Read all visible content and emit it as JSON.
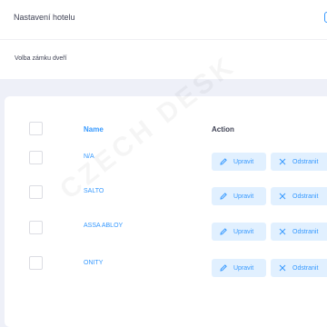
{
  "header": {
    "title": "Nastavení hotelu"
  },
  "subheader": {
    "title": "Volba zámku dveří"
  },
  "watermark": {
    "text": "CZECH DESK"
  },
  "table": {
    "columns": {
      "name": "Name",
      "action": "Action"
    },
    "rows": [
      {
        "name": "N/A"
      },
      {
        "name": "SALTO"
      },
      {
        "name": "ASSA ABLOY"
      },
      {
        "name": "ONITY"
      }
    ],
    "edit_label": "Upravit",
    "delete_label": "Odstranit"
  },
  "colors": {
    "accent": "#3699ff",
    "accent_light": "#e1f0ff",
    "page_bg": "#eef0f8"
  },
  "icons": {
    "edit": "pencil-icon",
    "delete": "close-icon"
  }
}
